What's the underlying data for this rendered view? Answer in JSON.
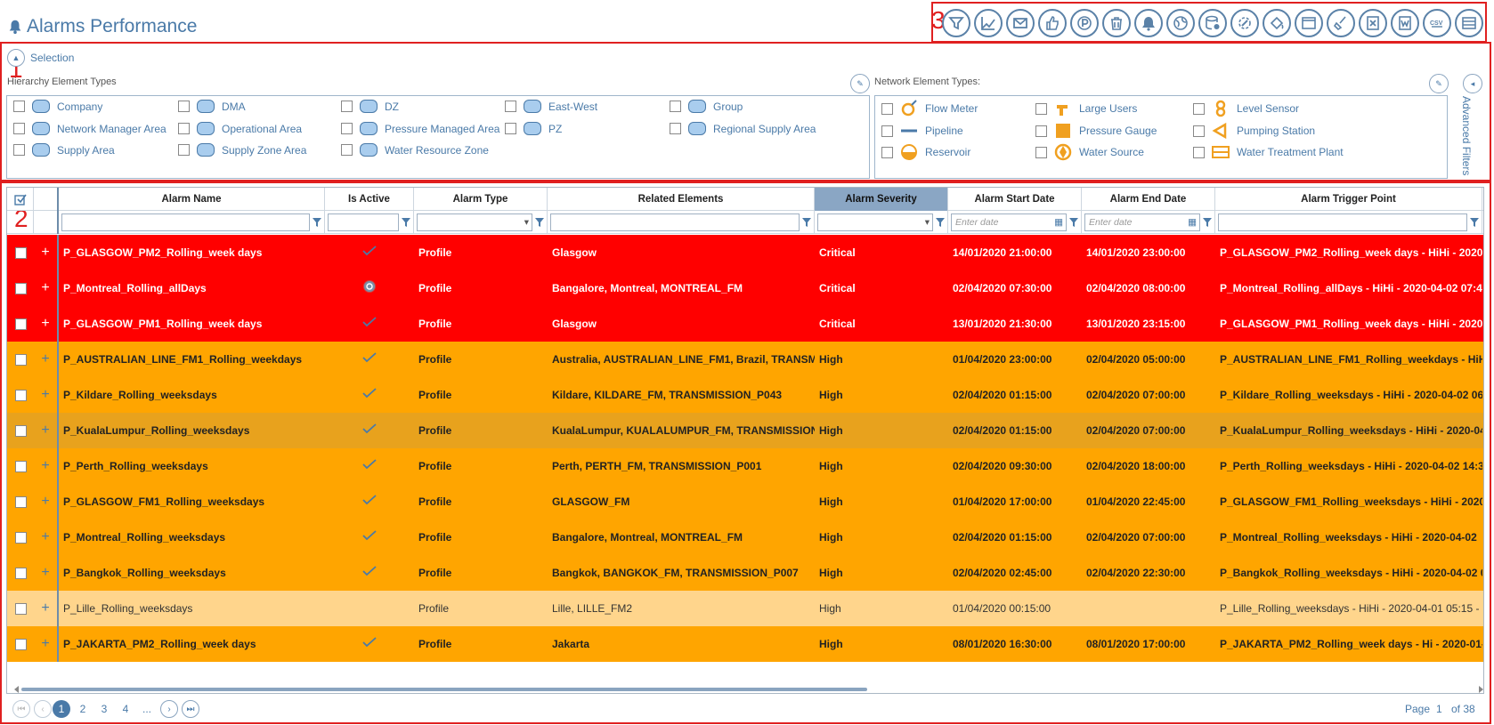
{
  "app": {
    "title": "Alarms Performance"
  },
  "annotations": [
    "1",
    "2",
    "3"
  ],
  "selection": {
    "label": "Selection",
    "hierarchy_label": "Hierarchy Element Types",
    "network_label": "Network Element Types:",
    "advanced_filters": "Advanced Filters",
    "hierarchy_items": [
      [
        "Company",
        "DMA",
        "DZ",
        "East-West",
        "Group"
      ],
      [
        "Network Manager Area",
        "Operational Area",
        "Pressure Managed Area",
        "PZ",
        "Regional Supply Area"
      ],
      [
        "Supply Area",
        "Supply Zone Area",
        "Water Resource Zone"
      ]
    ],
    "network_items": [
      [
        "Flow Meter",
        "Large Users",
        "Level Sensor"
      ],
      [
        "Pipeline",
        "Pressure Gauge",
        "Pumping Station"
      ],
      [
        "Reservoir",
        "Water Source",
        "Water Treatment Plant"
      ]
    ]
  },
  "grid": {
    "columns": [
      "Alarm Name",
      "Is Active",
      "Alarm Type",
      "Related Elements",
      "Alarm Severity",
      "Alarm Start Date",
      "Alarm End Date",
      "Alarm Trigger Point"
    ],
    "date_placeholder": "Enter date",
    "rows": [
      {
        "sev": "critical",
        "name": "P_GLASGOW_PM2_Rolling_week days",
        "active": "check",
        "type": "Profile",
        "related": "Glasgow",
        "severity": "Critical",
        "start": "14/01/2020 21:00:00",
        "end": "14/01/2020 23:00:00",
        "trigger": "P_GLASGOW_PM2_Rolling_week days - HiHi - 2020-01-14"
      },
      {
        "sev": "critical",
        "name": "P_Montreal_Rolling_allDays",
        "active": "circle",
        "type": "Profile",
        "related": "Bangalore, Montreal, MONTREAL_FM",
        "severity": "Critical",
        "start": "02/04/2020 07:30:00",
        "end": "02/04/2020 08:00:00",
        "trigger": "P_Montreal_Rolling_allDays - HiHi - 2020-04-02 07:4"
      },
      {
        "sev": "critical",
        "name": "P_GLASGOW_PM1_Rolling_week days",
        "active": "check",
        "type": "Profile",
        "related": "Glasgow",
        "severity": "Critical",
        "start": "13/01/2020 21:30:00",
        "end": "13/01/2020 23:15:00",
        "trigger": "P_GLASGOW_PM1_Rolling_week days - HiHi - 2020-"
      },
      {
        "sev": "high",
        "name": "P_AUSTRALIAN_LINE_FM1_Rolling_weekdays",
        "active": "check",
        "type": "Profile",
        "related": "Australia, AUSTRALIAN_LINE_FM1, Brazil, TRANSMI",
        "severity": "High",
        "start": "01/04/2020 23:00:00",
        "end": "02/04/2020 05:00:00",
        "trigger": "P_AUSTRALIAN_LINE_FM1_Rolling_weekdays - HiH"
      },
      {
        "sev": "high",
        "name": "P_Kildare_Rolling_weeksdays",
        "active": "check",
        "type": "Profile",
        "related": "Kildare, KILDARE_FM, TRANSMISSION_P043",
        "severity": "High",
        "start": "02/04/2020 01:15:00",
        "end": "02/04/2020 07:00:00",
        "trigger": "P_Kildare_Rolling_weeksdays - HiHi - 2020-04-02 06"
      },
      {
        "sev": "high sel",
        "name": "P_KualaLumpur_Rolling_weeksdays",
        "active": "check",
        "type": "Profile",
        "related": "KualaLumpur, KUALALUMPUR_FM, TRANSMISSION",
        "severity": "High",
        "start": "02/04/2020 01:15:00",
        "end": "02/04/2020 07:00:00",
        "trigger": "P_KualaLumpur_Rolling_weeksdays - HiHi - 2020-04-"
      },
      {
        "sev": "high",
        "name": "P_Perth_Rolling_weeksdays",
        "active": "check",
        "type": "Profile",
        "related": "Perth, PERTH_FM, TRANSMISSION_P001",
        "severity": "High",
        "start": "02/04/2020 09:30:00",
        "end": "02/04/2020 18:00:00",
        "trigger": "P_Perth_Rolling_weeksdays - HiHi - 2020-04-02 14:3"
      },
      {
        "sev": "high",
        "name": "P_GLASGOW_FM1_Rolling_weeksdays",
        "active": "check",
        "type": "Profile",
        "related": "GLASGOW_FM",
        "severity": "High",
        "start": "01/04/2020 17:00:00",
        "end": "01/04/2020 22:45:00",
        "trigger": "P_GLASGOW_FM1_Rolling_weeksdays - HiHi - 2020-04-"
      },
      {
        "sev": "high",
        "name": "P_Montreal_Rolling_weeksdays",
        "active": "check",
        "type": "Profile",
        "related": "Bangalore, Montreal, MONTREAL_FM",
        "severity": "High",
        "start": "02/04/2020 01:15:00",
        "end": "02/04/2020 07:00:00",
        "trigger": "P_Montreal_Rolling_weeksdays - HiHi - 2020-04-02"
      },
      {
        "sev": "high",
        "name": "P_Bangkok_Rolling_weeksdays",
        "active": "check",
        "type": "Profile",
        "related": "Bangkok, BANGKOK_FM, TRANSMISSION_P007",
        "severity": "High",
        "start": "02/04/2020 02:45:00",
        "end": "02/04/2020 22:30:00",
        "trigger": "P_Bangkok_Rolling_weeksdays - HiHi - 2020-04-02 0"
      },
      {
        "sev": "low",
        "name": "P_Lille_Rolling_weeksdays",
        "active": "",
        "type": "Profile",
        "related": "Lille, LILLE_FM2",
        "severity": "High",
        "start": "01/04/2020 00:15:00",
        "end": "",
        "trigger": "P_Lille_Rolling_weeksdays - HiHi - 2020-04-01 05:15 - F"
      },
      {
        "sev": "high",
        "name": "P_JAKARTA_PM2_Rolling_week days",
        "active": "check",
        "type": "Profile",
        "related": "Jakarta",
        "severity": "High",
        "start": "08/01/2020 16:30:00",
        "end": "08/01/2020 17:00:00",
        "trigger": "P_JAKARTA_PM2_Rolling_week days - Hi - 2020-01-"
      }
    ]
  },
  "pager": {
    "pages": [
      "1",
      "2",
      "3",
      "4",
      "..."
    ],
    "page_label": "Page",
    "current": "1",
    "of_label": "of 38"
  },
  "colors": {
    "critical": "#ff0000",
    "high": "#ffa500",
    "low": "#ffd58c",
    "accent": "#4a7aa8",
    "annotation": "#e02020"
  }
}
